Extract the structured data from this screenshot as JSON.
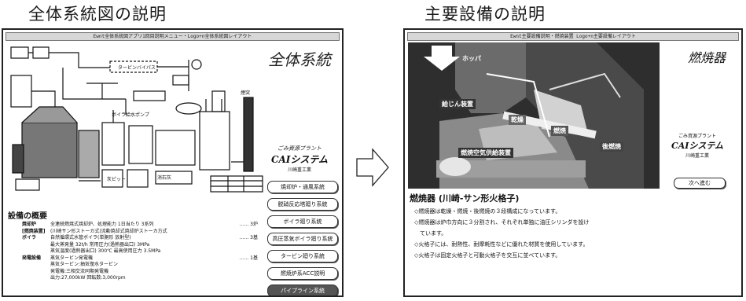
{
  "headings": {
    "left": "全体系統図の説明",
    "right": "主要設備の説明"
  },
  "left_panel": {
    "titlebar": "Ewnt全体系統図アプリ1回目説明メニュー・Logo+n全体系統図レイアウト",
    "system_title": "全体系統",
    "diagram_labels": {
      "turbine_bypass": "タービンバイパス",
      "boiler_pump": "ボイラ給水ポンプ",
      "chimney": "煙突",
      "ash": "灰ピット",
      "lime": "消石灰"
    },
    "company": {
      "line1": "ごみ資源プラント",
      "line2": "CAIシステム",
      "line3": "川崎重工業"
    },
    "menu": [
      "焼却炉・通風系統",
      "脱硝反応塔廻り系統",
      "ボイラ廻り系統",
      "高圧蒸気ボイラ廻り系統",
      "タービン廻り系統",
      "燃焼炉系ACC説明",
      "パイプライン系統"
    ],
    "overview_title": "設備の概要",
    "spec": [
      {
        "label": "焼却炉",
        "value": "全連続燃焼式焼却炉、処理能力 1日当たり 3系列",
        "count": "…… 3炉"
      },
      {
        "label": "[燃焼装置]",
        "value": "(川崎サン形ストーカ式)流動焼却式焼却炉ストーカ方式",
        "count": ""
      },
      {
        "label": "ボイラ",
        "value": "自然循環式水管ボイラ(単胴形 放射型)",
        "count": "…… 3基"
      },
      {
        "label": "",
        "value": "最大蒸発量 32t/h 常用圧力(過熱器出口) 3MPa",
        "count": ""
      },
      {
        "label": "",
        "value": "蒸気温度(過熱器出口) 300℃ 最高使用圧力 3.5MPa",
        "count": ""
      },
      {
        "label": "発電設備",
        "value": "蒸気タービン発電機",
        "count": "…… 1基"
      },
      {
        "label": "",
        "value": "蒸気タービン:抽気復水タービン",
        "count": ""
      },
      {
        "label": "",
        "value": "発電機:三相交流同期発電機",
        "count": ""
      },
      {
        "label": "",
        "value": "出力:27,000kW 回転数:3,000rpm",
        "count": ""
      }
    ]
  },
  "right_panel": {
    "titlebar": "Ewnt主要設備説明・燃焼装置 Logo+n主要設備レイアウト",
    "title": "燃焼器",
    "photo_labels": {
      "hopper": "ホッパ",
      "feeder": "給じん装置",
      "dry": "乾燥",
      "burn": "燃焼",
      "after": "後燃焼",
      "air": "燃焼空気供給装置"
    },
    "company": {
      "line1": "ごみ資源プラント",
      "line2": "CAIシステム",
      "line3": "川崎重工業"
    },
    "next_button": "次へ進む",
    "caption": "燃焼器 (川崎-サン形火格子)",
    "bullets": [
      "◇燃焼器は乾燥・燃焼・後燃焼の３段構成になっています。",
      "◇燃焼器は炉巾方向に３分割され、それぞれ単独に油圧シリンダを設け",
      "　ています。",
      "◇火格子には、耐熱性、耐摩耗性などに優れた材質を使用しています。",
      "◇火格子は固定火格子と可動火格子を交互に並べています。"
    ]
  }
}
